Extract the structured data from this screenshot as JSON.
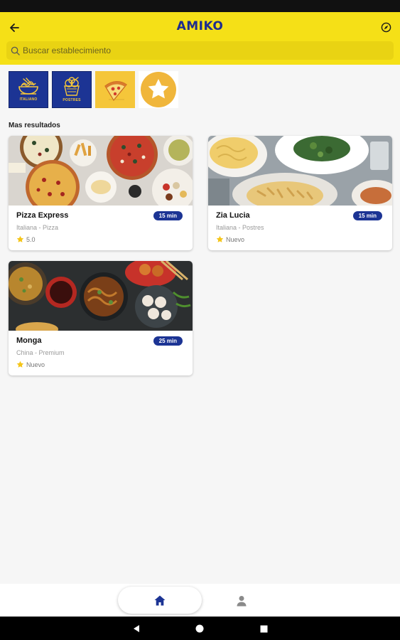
{
  "header": {
    "brand": "AMIKO",
    "back_icon": "arrow-left-icon",
    "location_icon": "compass-icon",
    "background_color": "#f5e017",
    "brand_color": "#1d2c8f"
  },
  "search": {
    "placeholder": "Buscar establecimiento",
    "value": ""
  },
  "categories": [
    {
      "label": "ITALIANO",
      "icon": "pasta-bowl-icon"
    },
    {
      "label": "POSTRES",
      "icon": "ice-cream-cup-icon"
    },
    {
      "label": "",
      "icon": "pizza-slice-icon"
    },
    {
      "label": "",
      "icon": "star-badge-icon"
    }
  ],
  "section_title": "Mas resultados",
  "restaurants": [
    {
      "name": "Pizza Express",
      "tags": "Italiana - Pizza",
      "rating": "5.0",
      "time": "15 min"
    },
    {
      "name": "Zia Lucia",
      "tags": "Italiana - Postres",
      "rating": "Nuevo",
      "time": "15 min"
    },
    {
      "name": "Monga",
      "tags": "China - Premium",
      "rating": "Nuevo",
      "time": "25 min"
    }
  ],
  "nav": {
    "home_icon": "home-icon",
    "profile_icon": "person-icon"
  },
  "accent_blue": "#1c3494"
}
